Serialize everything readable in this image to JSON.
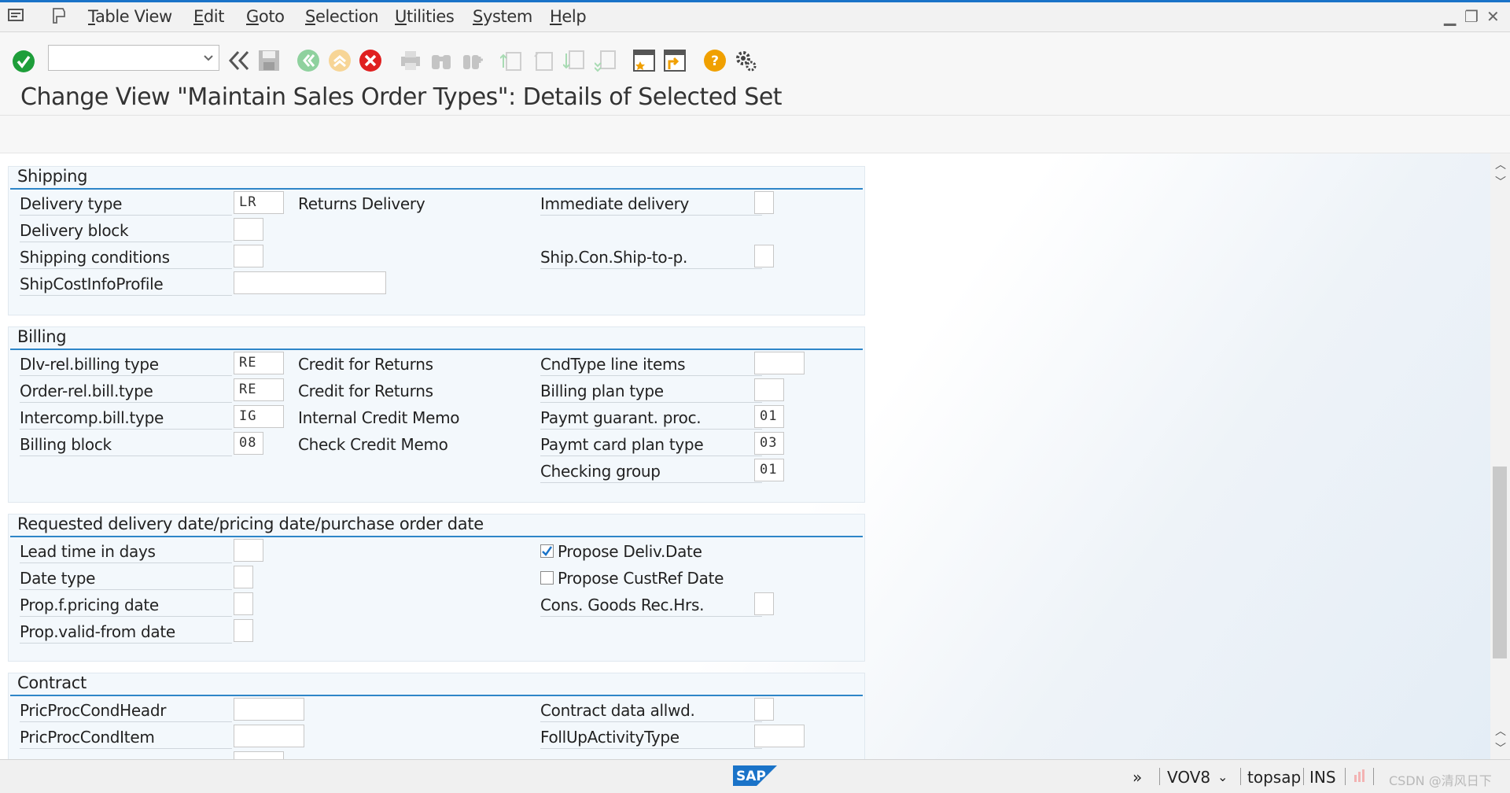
{
  "menu": {
    "items": [
      "Table View",
      "Edit",
      "Goto",
      "Selection",
      "Utilities",
      "System",
      "Help"
    ]
  },
  "toolbar": {
    "command_value": "",
    "icons": [
      "enter-icon",
      "back-icon",
      "save-icon",
      "back-green-icon",
      "exit-icon",
      "cancel-icon",
      "print-icon",
      "find-icon",
      "find-next-icon",
      "first-page-icon",
      "previous-page-icon",
      "next-page-icon",
      "last-page-icon",
      "new-session-icon",
      "shortcut-icon",
      "help-icon",
      "customize-layout-icon"
    ]
  },
  "title": "Change View \"Maintain Sales Order Types\": Details of Selected Set",
  "shipping": {
    "title": "Shipping",
    "delivery_type": {
      "label": "Delivery type",
      "value": "LR",
      "text": "Returns Delivery"
    },
    "delivery_block": {
      "label": "Delivery block",
      "value": ""
    },
    "shipping_conditions": {
      "label": "Shipping conditions",
      "value": ""
    },
    "ship_cost_profile": {
      "label": "ShipCostInfoProfile",
      "value": ""
    },
    "immediate_delivery": {
      "label": "Immediate delivery",
      "value": ""
    },
    "ship_con_ship_to": {
      "label": "Ship.Con.Ship-to-p.",
      "value": ""
    }
  },
  "billing": {
    "title": "Billing",
    "dlv_rel_billing": {
      "label": "Dlv-rel.billing type",
      "value": "RE",
      "text": "Credit for Returns"
    },
    "order_rel_billing": {
      "label": "Order-rel.bill.type",
      "value": "RE",
      "text": "Credit for Returns"
    },
    "intercomp_billing": {
      "label": "Intercomp.bill.type",
      "value": "IG",
      "text": "Internal Credit Memo"
    },
    "billing_block": {
      "label": "Billing block",
      "value": "08",
      "text": "Check Credit Memo"
    },
    "cndtype_line_items": {
      "label": "CndType line items",
      "value": ""
    },
    "billing_plan_type": {
      "label": "Billing plan type",
      "value": ""
    },
    "paymt_guarant": {
      "label": "Paymt guarant. proc.",
      "value": "01"
    },
    "paymt_card_plan": {
      "label": "Paymt card plan type",
      "value": "03"
    },
    "checking_group": {
      "label": "Checking group",
      "value": "01"
    }
  },
  "dates": {
    "title": "Requested delivery date/pricing date/purchase order date",
    "lead_time": {
      "label": "Lead time in days",
      "value": ""
    },
    "date_type": {
      "label": "Date type",
      "value": ""
    },
    "prop_pricing_date": {
      "label": "Prop.f.pricing date",
      "value": ""
    },
    "prop_valid_from": {
      "label": "Prop.valid-from date",
      "value": ""
    },
    "propose_deliv_date": {
      "label": "Propose Deliv.Date",
      "checked": true
    },
    "propose_custref_date": {
      "label": "Propose CustRef Date",
      "checked": false
    },
    "cons_goods_rec": {
      "label": "Cons. Goods Rec.Hrs.",
      "value": ""
    }
  },
  "contract": {
    "title": "Contract",
    "pricproc_headr": {
      "label": "PricProcCondHeadr",
      "value": ""
    },
    "pricproc_item": {
      "label": "PricProcCondItem",
      "value": ""
    },
    "contract_data": {
      "label": "Contract data allwd.",
      "value": ""
    },
    "follup_activity": {
      "label": "FollUpActivityType",
      "value": ""
    }
  },
  "status": {
    "transaction": "VOV8",
    "user": "topsap",
    "mode": "INS",
    "watermark": "CSDN @清风日下",
    "logo": "SAP"
  },
  "colors": {
    "accent": "#2e86c8",
    "ok_green": "#1e9e3a",
    "cancel_red": "#e02020",
    "help_orange": "#f0a000"
  }
}
